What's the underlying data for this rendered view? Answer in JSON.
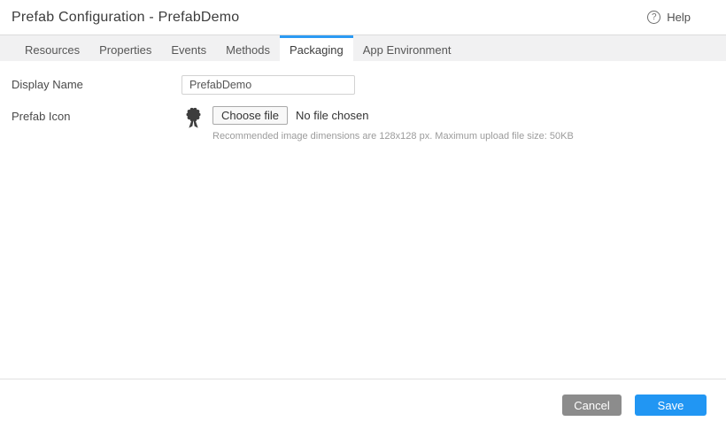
{
  "header": {
    "title": "Prefab Configuration - PrefabDemo",
    "help_label": "Help",
    "help_icon_symbol": "?"
  },
  "tabs": {
    "resources": "Resources",
    "properties": "Properties",
    "events": "Events",
    "methods": "Methods",
    "packaging": "Packaging",
    "app_environment": "App Environment",
    "active_tab": "Packaging"
  },
  "form": {
    "display_name": {
      "label": "Display Name",
      "value": "PrefabDemo"
    },
    "prefab_icon": {
      "label": "Prefab Icon",
      "icon": "award-ribbon-icon",
      "choose_file_label": "Choose file",
      "file_status": "No file chosen",
      "hint": "Recommended image dimensions are 128x128 px. Maximum upload file size: 50KB"
    }
  },
  "footer": {
    "cancel_label": "Cancel",
    "save_label": "Save"
  },
  "colors": {
    "accent_blue": "#2196f3",
    "active_tab_indicator": "#2b9af3",
    "cancel_button_gray": "#8c8c8c",
    "tab_bar_bg": "#f1f1f2"
  }
}
